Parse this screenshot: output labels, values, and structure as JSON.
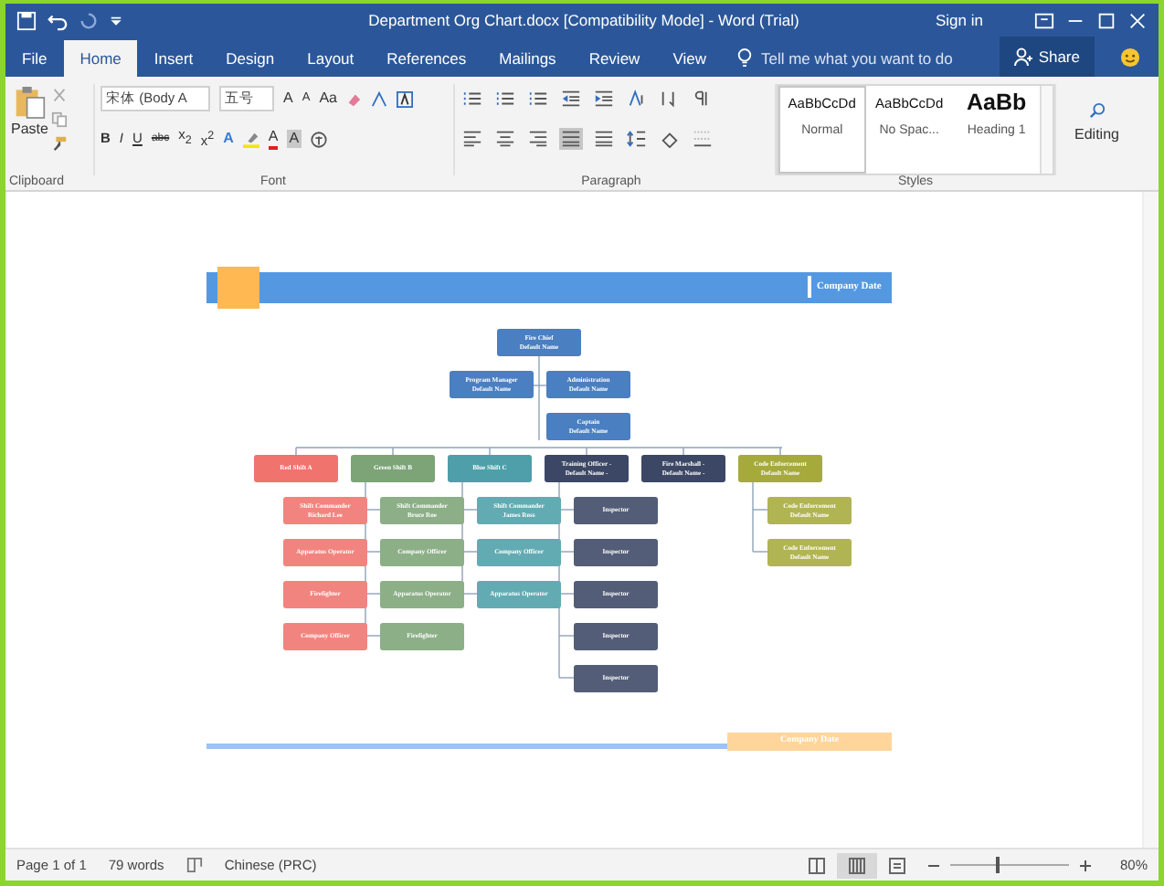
{
  "window": {
    "title": "Department Org Chart.docx [Compatibility Mode]  -  Word (Trial)",
    "sign_in": "Sign in"
  },
  "tabs": [
    {
      "label": "File",
      "selected": false
    },
    {
      "label": "Home",
      "selected": true
    },
    {
      "label": "Insert",
      "selected": false
    },
    {
      "label": "Design",
      "selected": false
    },
    {
      "label": "Layout",
      "selected": false
    },
    {
      "label": "References",
      "selected": false
    },
    {
      "label": "Mailings",
      "selected": false
    },
    {
      "label": "Review",
      "selected": false
    },
    {
      "label": "View",
      "selected": false
    }
  ],
  "tell_me": {
    "placeholder": "Tell me what you want to do"
  },
  "share": "Share",
  "ribbon": {
    "clipboard": {
      "paste": "Paste",
      "label": "Clipboard"
    },
    "font": {
      "label": "Font",
      "name": "宋体 (Body A",
      "size": "五号",
      "size_buttons": [
        "A",
        "A",
        "Aa"
      ],
      "format_buttons": [
        "B",
        "I",
        "U",
        "abc",
        "x$_{2}$",
        "x$^{2}$"
      ],
      "text_effects": "A",
      "font_color": "A",
      "char_shading": "A"
    },
    "paragraph": {
      "label": "Paragraph"
    },
    "styles": {
      "label": "Styles",
      "items": [
        {
          "preview": "AaBbCcDd",
          "label": "Normal",
          "selected": true,
          "kind": "body"
        },
        {
          "preview": "AaBbCcDd",
          "label": "No Spac...",
          "selected": false,
          "kind": "body"
        },
        {
          "preview": "AaBb",
          "label": "Heading 1",
          "selected": false,
          "kind": "heading"
        }
      ]
    },
    "editing": "Editing"
  },
  "document": {
    "header_text": "Company Date",
    "footer_text": "Company Date",
    "org": {
      "chief": {
        "title": "Fire Chief",
        "name": "Default Name"
      },
      "staff": [
        {
          "title": "Program Manager",
          "name": "Default Name"
        },
        {
          "title": "Administration",
          "name": "Default Name"
        }
      ],
      "captain": {
        "title": "Captain",
        "name": "Default Name"
      },
      "divisions": [
        {
          "title": "Red Shift A",
          "color": "#f0736e",
          "members": [
            {
              "title": "Shift Commander",
              "name": "Richard Lee"
            },
            {
              "title": "Apparatus Operator"
            },
            {
              "title": "Firefighter"
            },
            {
              "title": "Company Officer"
            }
          ]
        },
        {
          "title": "Green Shift B",
          "color": "#7ca477",
          "members": [
            {
              "title": "Shift Commander",
              "name": "Bruce Roe"
            },
            {
              "title": "Company Officer"
            },
            {
              "title": "Apparatus Operator"
            },
            {
              "title": "Firefighter"
            }
          ]
        },
        {
          "title": "Blue Shift C",
          "color": "#4e9fa9",
          "members": [
            {
              "title": "Shift Commander",
              "name": "James Ross"
            },
            {
              "title": "Company Officer"
            },
            {
              "title": "Apparatus Operator"
            }
          ]
        },
        {
          "title": "Training Officer -",
          "name": "Default Name -",
          "color": "#3b4764",
          "members": [
            {
              "title": "Inspector"
            },
            {
              "title": "Inspector"
            },
            {
              "title": "Inspector"
            },
            {
              "title": "Inspector"
            },
            {
              "title": "Inspector"
            }
          ]
        },
        {
          "title": "Fire Marshall -",
          "name": "Default Name -",
          "color": "#3b4764"
        },
        {
          "title": "Code Enforcement",
          "name": "Default Name",
          "color": "#a6aa3a",
          "members": [
            {
              "title": "Code Enforcement",
              "name": "Default Name"
            },
            {
              "title": "Code Enforcement",
              "name": "Default Name"
            }
          ]
        }
      ]
    }
  },
  "status_bar": {
    "page": "Page 1 of 1",
    "words": "79 words",
    "language": "Chinese (PRC)",
    "views": [
      {
        "selected": false
      },
      {
        "selected": true
      },
      {
        "selected": false
      }
    ],
    "zoom_slider": {
      "level": 0.4
    },
    "zoom": "80%"
  }
}
